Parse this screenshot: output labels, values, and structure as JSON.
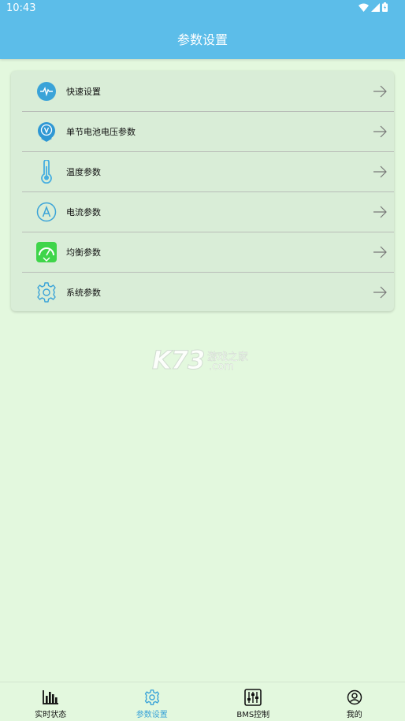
{
  "status_bar": {
    "time": "10:43"
  },
  "header": {
    "title": "参数设置"
  },
  "menu": {
    "items": [
      {
        "label": "快速设置",
        "icon": "pulse-icon"
      },
      {
        "label": "单节电池电压参数",
        "icon": "voltage-icon"
      },
      {
        "label": "温度参数",
        "icon": "thermometer-icon"
      },
      {
        "label": "电流参数",
        "icon": "ampere-icon"
      },
      {
        "label": "均衡参数",
        "icon": "balance-gauge-icon"
      },
      {
        "label": "系统参数",
        "icon": "gear-icon"
      }
    ]
  },
  "watermark": {
    "logo": "K73",
    "cn": "游戏之家",
    "domain": ".com"
  },
  "bottom_nav": {
    "items": [
      {
        "label": "实时状态",
        "icon": "bar-chart-icon",
        "active": false
      },
      {
        "label": "参数设置",
        "icon": "gear-icon",
        "active": true
      },
      {
        "label": "BMS控制",
        "icon": "sliders-icon",
        "active": false
      },
      {
        "label": "我的",
        "icon": "user-icon",
        "active": false
      }
    ]
  },
  "colors": {
    "header": "#5cbde9",
    "background": "#e3f8de",
    "card": "#d9edd7",
    "accent": "#3aa3d8",
    "balance_icon": "#3fd54a"
  }
}
